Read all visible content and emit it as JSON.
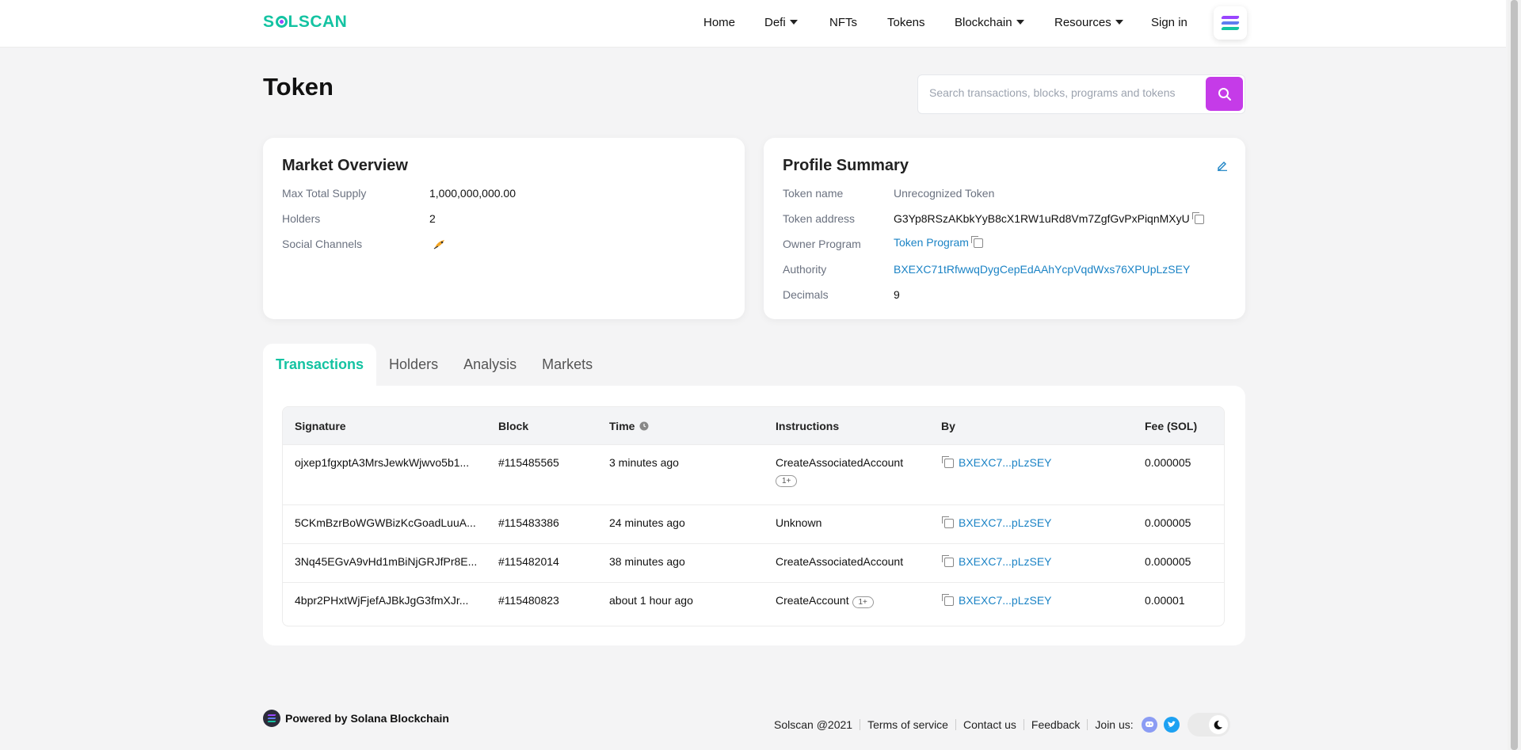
{
  "brand": {
    "logo_pre": "S",
    "logo_post": "LSCAN"
  },
  "nav": {
    "home": "Home",
    "defi": "Defi",
    "nfts": "NFTs",
    "tokens": "Tokens",
    "blockchain": "Blockchain",
    "resources": "Resources",
    "signin": "Sign in"
  },
  "page": {
    "title": "Token"
  },
  "search": {
    "placeholder": "Search transactions, blocks, programs and tokens"
  },
  "market": {
    "title": "Market Overview",
    "rows": [
      {
        "label": "Max Total Supply",
        "value": "1,000,000,000.00"
      },
      {
        "label": "Holders",
        "value": "2"
      },
      {
        "label": "Social Channels",
        "value": ""
      }
    ]
  },
  "profile": {
    "title": "Profile Summary",
    "token_name_label": "Token name",
    "token_name": "Unrecognized Token",
    "token_address_label": "Token address",
    "token_address": "G3Yp8RSzAKbkYyB8cX1RW1uRd8Vm7ZgfGvPxPiqnMXyU",
    "owner_program_label": "Owner Program",
    "owner_program": "Token Program",
    "authority_label": "Authority",
    "authority": "BXEXC71tRfwwqDygCepEdAAhYcpVqdWxs76XPUpLzSEY",
    "decimals_label": "Decimals",
    "decimals": "9"
  },
  "tabs": [
    "Transactions",
    "Holders",
    "Analysis",
    "Markets"
  ],
  "table": {
    "headers": {
      "signature": "Signature",
      "block": "Block",
      "time": "Time",
      "instructions": "Instructions",
      "by": "By",
      "fee": "Fee (SOL)"
    },
    "rows": [
      {
        "signature": "ojxep1fgxptA3MrsJewkWjwvo5b1...",
        "block": "#115485565",
        "time": "3 minutes ago",
        "instruction": "CreateAssociatedAccount",
        "extra": "1+",
        "by": "BXEXC7...pLzSEY",
        "fee": "0.000005"
      },
      {
        "signature": "5CKmBzrBoWGWBizKcGoadLuuA...",
        "block": "#115483386",
        "time": "24 minutes ago",
        "instruction": "Unknown",
        "extra": "",
        "by": "BXEXC7...pLzSEY",
        "fee": "0.000005"
      },
      {
        "signature": "3Nq45EGvA9vHd1mBiNjGRJfPr8E...",
        "block": "#115482014",
        "time": "38 minutes ago",
        "instruction": "CreateAssociatedAccount",
        "extra": "",
        "by": "BXEXC7...pLzSEY",
        "fee": "0.000005"
      },
      {
        "signature": "4bpr2PHxtWjFjefAJBkJgG3fmXJr...",
        "block": "#115480823",
        "time": "about 1 hour ago",
        "instruction": "CreateAccount",
        "extra": "1+",
        "by": "BXEXC7...pLzSEY",
        "fee": "0.00001"
      }
    ]
  },
  "footer": {
    "powered": "Powered by Solana Blockchain",
    "copyright": "Solscan @2021",
    "terms": "Terms of service",
    "contact": "Contact us",
    "feedback": "Feedback",
    "join": "Join us:"
  },
  "colors": {
    "accent": "#14c3a2",
    "search_button": "#c53be8",
    "link": "#1b83c5"
  }
}
